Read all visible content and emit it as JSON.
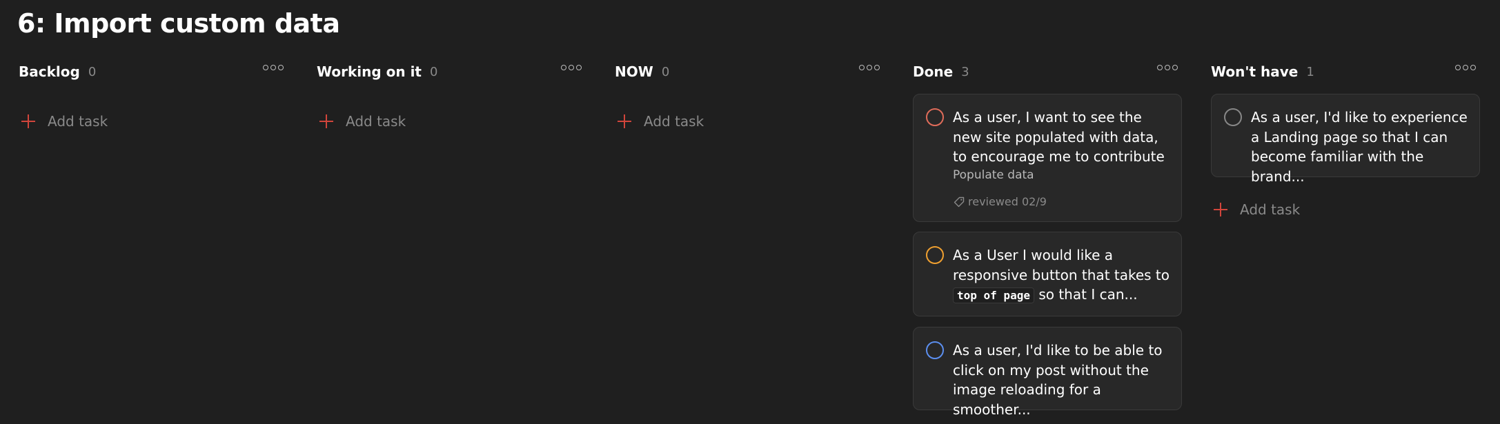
{
  "project": {
    "title": "6: Import custom data"
  },
  "icons": {
    "more": "more-horizontal-icon",
    "add": "plus-icon",
    "label": "tag-icon",
    "check": "circle-checkbox-icon"
  },
  "colors": {
    "background": "#1f1f1f",
    "card": "#282828",
    "accent": "#d1453b",
    "priority_1": "#e06c5a",
    "priority_2": "#f0a030",
    "priority_3": "#5c8ff0",
    "priority_4": "#888888"
  },
  "add_task_label": "Add task",
  "columns": [
    {
      "name": "Backlog",
      "count": "0"
    },
    {
      "name": "Working on it",
      "count": "0"
    },
    {
      "name": "NOW",
      "count": "0"
    },
    {
      "name": "Done",
      "count": "3"
    },
    {
      "name": "Won't have",
      "count": "1"
    }
  ],
  "done_tasks": [
    {
      "content": "As a user, I want to see the new site populated with data, to encourage me to contribute",
      "description": "Populate data",
      "label": "reviewed 02/9",
      "priority_color": "#e06c5a"
    },
    {
      "content_before": "As a User I would like a responsive button that takes to",
      "code": "top of page",
      "content_after": "so that I can...",
      "priority_color": "#f0a030"
    },
    {
      "content": "As a user, I'd like to be able to click on my post without the image reloading for a smoother...",
      "priority_color": "#5c8ff0"
    }
  ],
  "wont_have_tasks": [
    {
      "content": "As a user, I'd like to experience a Landing page so that I can become familiar with the brand...",
      "priority_color": "#888888"
    }
  ]
}
